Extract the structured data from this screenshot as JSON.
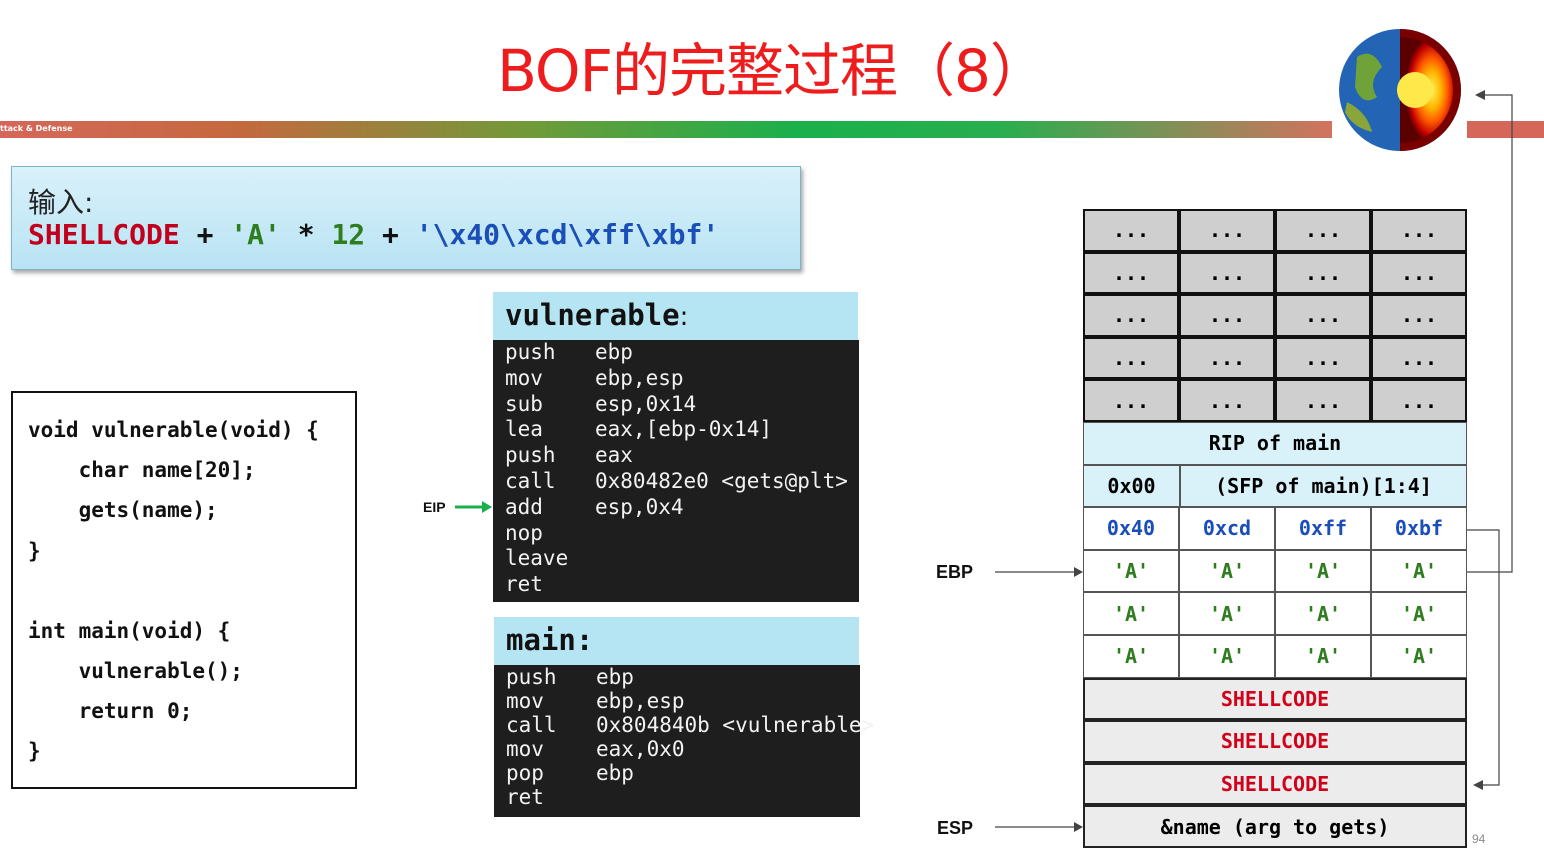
{
  "slide": {
    "title": "BOF的完整过程（8）",
    "bar_text": "ttack & Defense",
    "page_number": "94"
  },
  "input": {
    "label": "输入:",
    "parts": [
      "SHELLCODE",
      " + ",
      "'A'",
      " * ",
      "12",
      " + ",
      "'\\x40\\xcd\\xff\\xbf'"
    ]
  },
  "source_code": {
    "lines": [
      "void vulnerable(void) {",
      "    char name[20];",
      "    gets(name);",
      "}",
      "",
      "int main(void) {",
      "    vulnerable();",
      "    return 0;",
      "}"
    ]
  },
  "vulnerable_asm": {
    "title": "vulnerable",
    "title_suffix": ":",
    "lines": [
      {
        "op": "push",
        "arg": "ebp"
      },
      {
        "op": "mov",
        "arg": "ebp,esp"
      },
      {
        "op": "sub",
        "arg": "esp,0x14"
      },
      {
        "op": "lea",
        "arg": "eax,[ebp-0x14]"
      },
      {
        "op": "push",
        "arg": "eax"
      },
      {
        "op": "call",
        "arg": "0x80482e0 <gets@plt>"
      },
      {
        "op": "add",
        "arg": "esp,0x4"
      },
      {
        "op": "nop",
        "arg": ""
      },
      {
        "op": "leave",
        "arg": ""
      },
      {
        "op": "ret",
        "arg": ""
      }
    ]
  },
  "main_asm": {
    "title": "main:",
    "lines": [
      {
        "op": "push",
        "arg": "ebp"
      },
      {
        "op": "mov",
        "arg": "ebp,esp"
      },
      {
        "op": "call",
        "arg": "0x804840b <vulnerable>"
      },
      {
        "op": "mov",
        "arg": "eax,0x0"
      },
      {
        "op": "pop",
        "arg": "ebp"
      },
      {
        "op": "ret",
        "arg": ""
      }
    ]
  },
  "labels": {
    "eip": "EIP",
    "ebp": "EBP",
    "esp": "ESP"
  },
  "stack": {
    "rows": [
      {
        "style": "gray",
        "cells": [
          "...",
          "...",
          "...",
          "..."
        ]
      },
      {
        "style": "gray",
        "cells": [
          "...",
          "...",
          "...",
          "..."
        ]
      },
      {
        "style": "gray",
        "cells": [
          "...",
          "...",
          "...",
          "..."
        ]
      },
      {
        "style": "gray",
        "cells": [
          "...",
          "...",
          "...",
          "..."
        ]
      },
      {
        "style": "gray",
        "cells": [
          "...",
          "...",
          "...",
          "..."
        ]
      },
      {
        "style": "lite",
        "span": "RIP of main"
      },
      {
        "style": "lite",
        "split": [
          "0x00",
          "(SFP of main)[1:4]"
        ]
      },
      {
        "style": "plain",
        "color": "#1a4fb8",
        "cells": [
          "0x40",
          "0xcd",
          "0xff",
          "0xbf"
        ]
      },
      {
        "style": "plain",
        "color": "#2e7d1e",
        "cells": [
          "'A'",
          "'A'",
          "'A'",
          "'A'"
        ]
      },
      {
        "style": "plain",
        "color": "#2e7d1e",
        "cells": [
          "'A'",
          "'A'",
          "'A'",
          "'A'"
        ]
      },
      {
        "style": "plain",
        "color": "#2e7d1e",
        "cells": [
          "'A'",
          "'A'",
          "'A'",
          "'A'"
        ]
      },
      {
        "style": "shell",
        "color": "#d0021b",
        "span": "SHELLCODE"
      },
      {
        "style": "shell",
        "color": "#d0021b",
        "span": "SHELLCODE"
      },
      {
        "style": "shell",
        "color": "#d0021b",
        "span": "SHELLCODE"
      },
      {
        "style": "shell",
        "span": "&name (arg to gets)"
      }
    ]
  },
  "colors": {
    "title": "#ee1c1c",
    "shellcode": "#d0021b",
    "a_green": "#2e7d1e",
    "addr_blue": "#1a4fb8"
  }
}
